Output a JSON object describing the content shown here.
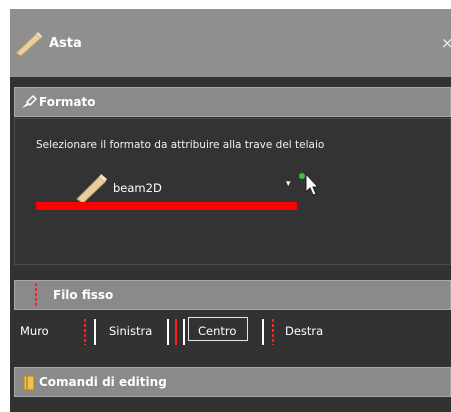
{
  "window": {
    "title": "Asta",
    "close_symbol": "×"
  },
  "sections": {
    "formato": {
      "label": "Formato",
      "instruction": "Selezionare il formato da attribuire alla trave del telaio",
      "selected_value": "beam2D",
      "dropdown_arrow": "▾"
    },
    "filo_fisso": {
      "label": "Filo fisso",
      "options_label": "Muro",
      "options": [
        "Sinistra",
        "Centro",
        "Destra"
      ],
      "selected": "Centro"
    },
    "comandi": {
      "label": "Comandi di editing"
    }
  },
  "colors": {
    "highlight_red": "#ff0000",
    "header_gray": "#8a8a8a",
    "body_dark": "#323232"
  },
  "icons": [
    "beam-icon",
    "brush-icon",
    "red-dashed-line-icon",
    "cursor-icon",
    "book-icon"
  ]
}
